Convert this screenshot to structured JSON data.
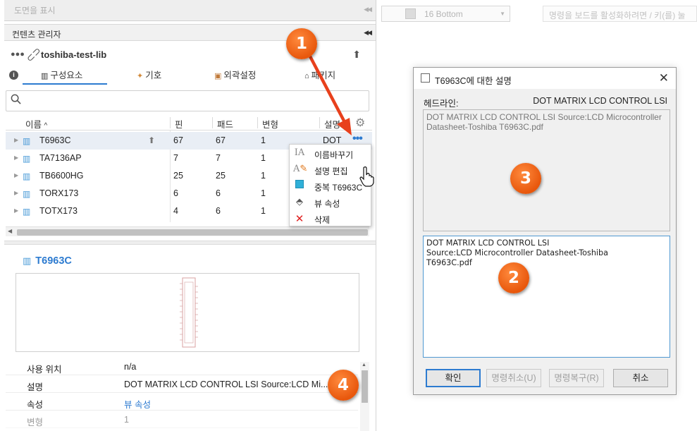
{
  "topbar": {
    "title": "도면을 표시"
  },
  "content_manager": {
    "title": "컨텐츠 관리자",
    "library_name": "toshiba-test-lib"
  },
  "tabs": [
    {
      "label": "구성요소"
    },
    {
      "label": "기호"
    },
    {
      "label": "외곽설정"
    },
    {
      "label": "패키지"
    }
  ],
  "grid": {
    "columns": [
      "이름",
      "핀",
      "패드",
      "변형",
      "설명"
    ],
    "rows": [
      {
        "name": "T6963C",
        "pins": "67",
        "pads": "67",
        "variants": "1",
        "desc": "DOT"
      },
      {
        "name": "TA7136AP",
        "pins": "7",
        "pads": "7",
        "variants": "1",
        "desc": ""
      },
      {
        "name": "TB6600HG",
        "pins": "25",
        "pads": "25",
        "variants": "1",
        "desc": ""
      },
      {
        "name": "TORX173",
        "pins": "6",
        "pads": "6",
        "variants": "1",
        "desc": ""
      },
      {
        "name": "TOTX173",
        "pins": "4",
        "pads": "6",
        "variants": "1",
        "desc": ""
      }
    ]
  },
  "context_menu": [
    {
      "label": "이름바꾸기",
      "icon": "rename-icon"
    },
    {
      "label": "설명 편집",
      "icon": "edit-description-icon"
    },
    {
      "label": "중복 T6963C",
      "icon": "duplicate-icon"
    },
    {
      "label": "뷰 속성",
      "icon": "tag-icon"
    },
    {
      "label": "삭제",
      "icon": "delete-icon"
    }
  ],
  "preview": {
    "title": "T6963C"
  },
  "properties": [
    {
      "key": "사용 위치",
      "value": "n/a"
    },
    {
      "key": "설명",
      "value": "DOT MATRIX LCD CONTROL LSI Source:LCD Mi..."
    },
    {
      "key": "속성",
      "value": "뷰 속성"
    },
    {
      "key": "변형",
      "value": "1"
    }
  ],
  "right_toolbar": {
    "layer": "16 Bottom",
    "hint": "명령을 보드를 활성화하려면 / 키(를) 눌"
  },
  "dialog": {
    "title": "T6963C에 대한 설명",
    "headline_label": "헤드라인:",
    "headline_value": "DOT MATRIX LCD CONTROL LSI",
    "preview_text": "DOT MATRIX LCD CONTROL LSI Source:LCD Microcontroller Datasheet-Toshiba T6963C.pdf",
    "edit_text": "DOT MATRIX LCD CONTROL LSI\nSource:LCD Microcontroller Datasheet-Toshiba\nT6963C.pdf",
    "buttons": {
      "ok": "확인",
      "undo": "명령취소(U)",
      "redo": "명령복구(R)",
      "cancel": "취소"
    }
  },
  "callouts": [
    "1",
    "2",
    "3",
    "4"
  ],
  "colors": {
    "accent": "#2d7bd0",
    "callout": "#f26a1b",
    "delete": "#e02020"
  }
}
